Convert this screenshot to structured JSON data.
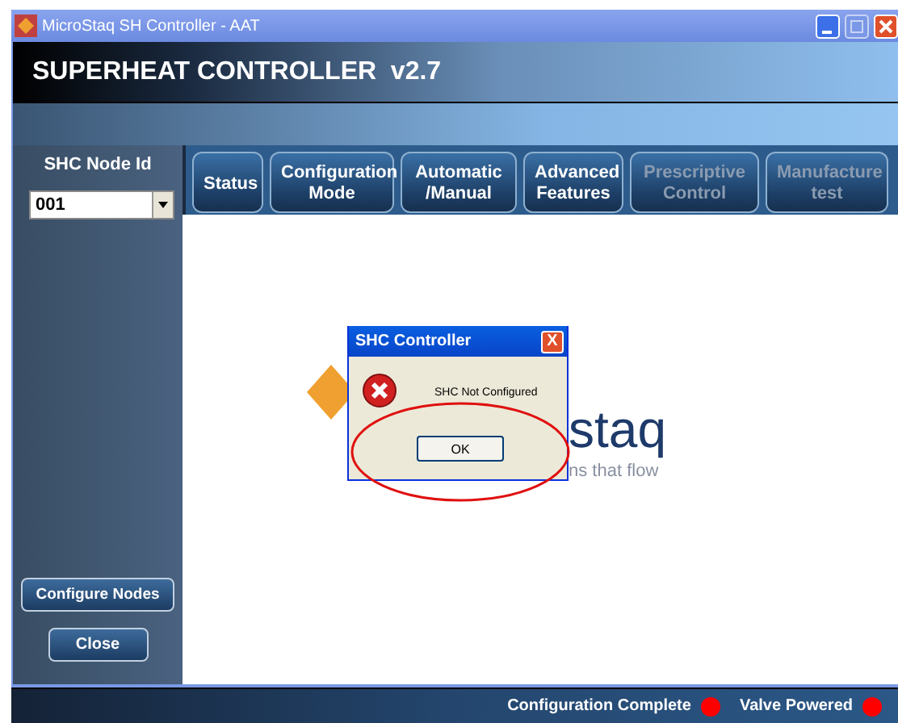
{
  "window": {
    "title": "MicroStaq SH Controller - AAT"
  },
  "header": {
    "title": "SUPERHEAT CONTROLLER  v2.7"
  },
  "sidebar": {
    "node_label": "SHC Node Id",
    "node_value": "001",
    "buttons": [
      "Configure Nodes",
      "Close"
    ]
  },
  "tabs": [
    {
      "label": "Status",
      "disabled": false
    },
    {
      "label": "Configuration Mode",
      "disabled": false
    },
    {
      "label": "Automatic /Manual",
      "disabled": false
    },
    {
      "label": "Advanced Features",
      "disabled": false
    },
    {
      "label": "Prescriptive Control",
      "disabled": true
    },
    {
      "label": "Manufacture test",
      "disabled": true
    }
  ],
  "logo": {
    "wordmark": "staq",
    "tagline": "ns that flow"
  },
  "dialog": {
    "title": "SHC Controller",
    "message": "SHC Not Configured",
    "button": "OK",
    "close": "X"
  },
  "status_bar": [
    {
      "label": "Configuration Complete",
      "color": "#ff0000"
    },
    {
      "label": "Valve Powered",
      "color": "#ff0000"
    }
  ]
}
